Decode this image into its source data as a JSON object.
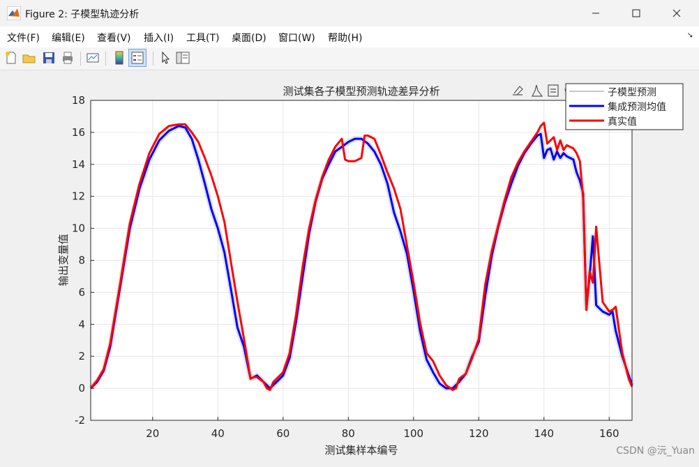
{
  "window": {
    "title": "Figure 2: 子模型轨迹分析"
  },
  "menu": [
    "文件(F)",
    "编辑(E)",
    "查看(V)",
    "插入(I)",
    "工具(T)",
    "桌面(D)",
    "窗口(W)",
    "帮助(H)"
  ],
  "toolbar_icons": [
    "new-figure-icon",
    "open-file-icon",
    "save-icon",
    "print-icon",
    "link-plot-icon",
    "colorbar-icon",
    "legend-icon",
    "edit-plot-icon",
    "property-inspector-icon"
  ],
  "axes_toolbar_icons": [
    "brush-icon",
    "data-tips-icon",
    "pan-icon",
    "zoom-in-icon",
    "zoom-out-icon",
    "home-icon"
  ],
  "watermark": "CSDN @沅_Yuan",
  "colors": {
    "ensemble": "#0000ff",
    "true": "#ff0000",
    "submodel": "#c8c8c8"
  },
  "chart_data": {
    "type": "line",
    "title": "测试集各子模型预测轨迹差异分析",
    "xlabel": "测试集样本编号",
    "ylabel": "输出变量值",
    "xlim": [
      1,
      167
    ],
    "ylim": [
      -2,
      18
    ],
    "xticks": [
      20,
      40,
      60,
      80,
      100,
      120,
      140,
      160
    ],
    "yticks": [
      -2,
      0,
      2,
      4,
      6,
      8,
      10,
      12,
      14,
      16,
      18
    ],
    "grid": true,
    "legend_position": "top-right",
    "legend": [
      "子模型预测",
      "集成预测均值",
      "真实值"
    ],
    "series": [
      {
        "name": "集成预测均值",
        "x": [
          1,
          3,
          5,
          7,
          10,
          13,
          16,
          19,
          22,
          25,
          28,
          30,
          32,
          34,
          36,
          38,
          40,
          42,
          44,
          46,
          48,
          50,
          52,
          54,
          56,
          58,
          60,
          62,
          64,
          66,
          68,
          70,
          72,
          74,
          76,
          78,
          80,
          82,
          84,
          86,
          88,
          90,
          92,
          94,
          96,
          98,
          100,
          102,
          104,
          106,
          108,
          110,
          112,
          114,
          116,
          118,
          120,
          122,
          124,
          126,
          128,
          130,
          132,
          134,
          136,
          138,
          139,
          140,
          141,
          142,
          143,
          144,
          145,
          146,
          147,
          148,
          149,
          150,
          151,
          152,
          153,
          154,
          155,
          156,
          158,
          160,
          161,
          162,
          164,
          166,
          167
        ],
        "values": [
          0,
          0.4,
          1.1,
          2.6,
          6.3,
          10.0,
          12.5,
          14.3,
          15.5,
          16.1,
          16.4,
          16.3,
          15.6,
          14.3,
          12.8,
          11.2,
          10.0,
          8.5,
          6.2,
          3.8,
          2.6,
          0.6,
          0.8,
          0.4,
          0,
          0.4,
          0.8,
          1.9,
          4.2,
          7.0,
          9.7,
          11.7,
          13.1,
          14.0,
          14.8,
          15.1,
          15.4,
          15.6,
          15.6,
          15.3,
          14.8,
          14.0,
          12.8,
          11.0,
          9.8,
          8.4,
          6.1,
          3.6,
          1.8,
          1.0,
          0.3,
          0,
          0,
          0.4,
          0.9,
          2.0,
          2.9,
          5.8,
          8.3,
          10.1,
          11.6,
          12.8,
          13.9,
          14.7,
          15.3,
          15.8,
          15.9,
          14.4,
          14.9,
          15.0,
          14.3,
          14.8,
          14.4,
          14.7,
          14.5,
          14.4,
          14.3,
          13.5,
          13.0,
          12.2,
          5.0,
          7.0,
          9.5,
          5.2,
          4.8,
          4.6,
          4.8,
          3.6,
          2.0,
          0.8,
          0.2
        ]
      },
      {
        "name": "真实值",
        "x": [
          1,
          3,
          5,
          7,
          10,
          13,
          16,
          19,
          22,
          25,
          28,
          30,
          32,
          34,
          36,
          38,
          40,
          42,
          44,
          46,
          48,
          50,
          51,
          52,
          54,
          55,
          56,
          57,
          58,
          60,
          62,
          64,
          66,
          68,
          70,
          72,
          74,
          76,
          78,
          79,
          80,
          81,
          82,
          84,
          85,
          86,
          88,
          90,
          92,
          94,
          96,
          98,
          100,
          102,
          104,
          106,
          108,
          110,
          112,
          113,
          114,
          116,
          118,
          120,
          122,
          124,
          126,
          128,
          130,
          132,
          134,
          136,
          138,
          139,
          140,
          141,
          142,
          143,
          144,
          145,
          146,
          147,
          148,
          149,
          150,
          151,
          152,
          153,
          154,
          155,
          156,
          158,
          160,
          161,
          162,
          164,
          166,
          167
        ],
        "values": [
          0,
          0.5,
          1.2,
          2.8,
          6.5,
          10.3,
          12.8,
          14.7,
          15.9,
          16.4,
          16.5,
          16.5,
          16.0,
          15.4,
          14.4,
          13.3,
          12.0,
          10.4,
          7.9,
          5.4,
          3.1,
          0.6,
          0.7,
          0.7,
          0.4,
          0,
          -0.1,
          0.4,
          0.6,
          1.0,
          2.2,
          4.6,
          7.6,
          10.0,
          11.8,
          13.2,
          14.3,
          15.1,
          15.6,
          14.3,
          14.2,
          14.2,
          14.2,
          14.4,
          15.8,
          15.8,
          15.6,
          14.6,
          13.5,
          12.5,
          11.2,
          8.9,
          6.6,
          4.1,
          2.2,
          1.7,
          0.8,
          0.2,
          -0.1,
          0,
          0.6,
          0.9,
          1.9,
          3.1,
          6.5,
          8.6,
          10.2,
          11.8,
          13.2,
          14.1,
          14.8,
          15.4,
          16.0,
          16.4,
          16.6,
          15.3,
          15.5,
          15.7,
          14.9,
          15.5,
          14.9,
          15.2,
          15.1,
          15.0,
          14.7,
          14.2,
          11.9,
          4.9,
          7.3,
          6.6,
          10.1,
          5.4,
          4.8,
          4.9,
          5.1,
          2.2,
          0.6,
          0.1
        ]
      }
    ]
  }
}
